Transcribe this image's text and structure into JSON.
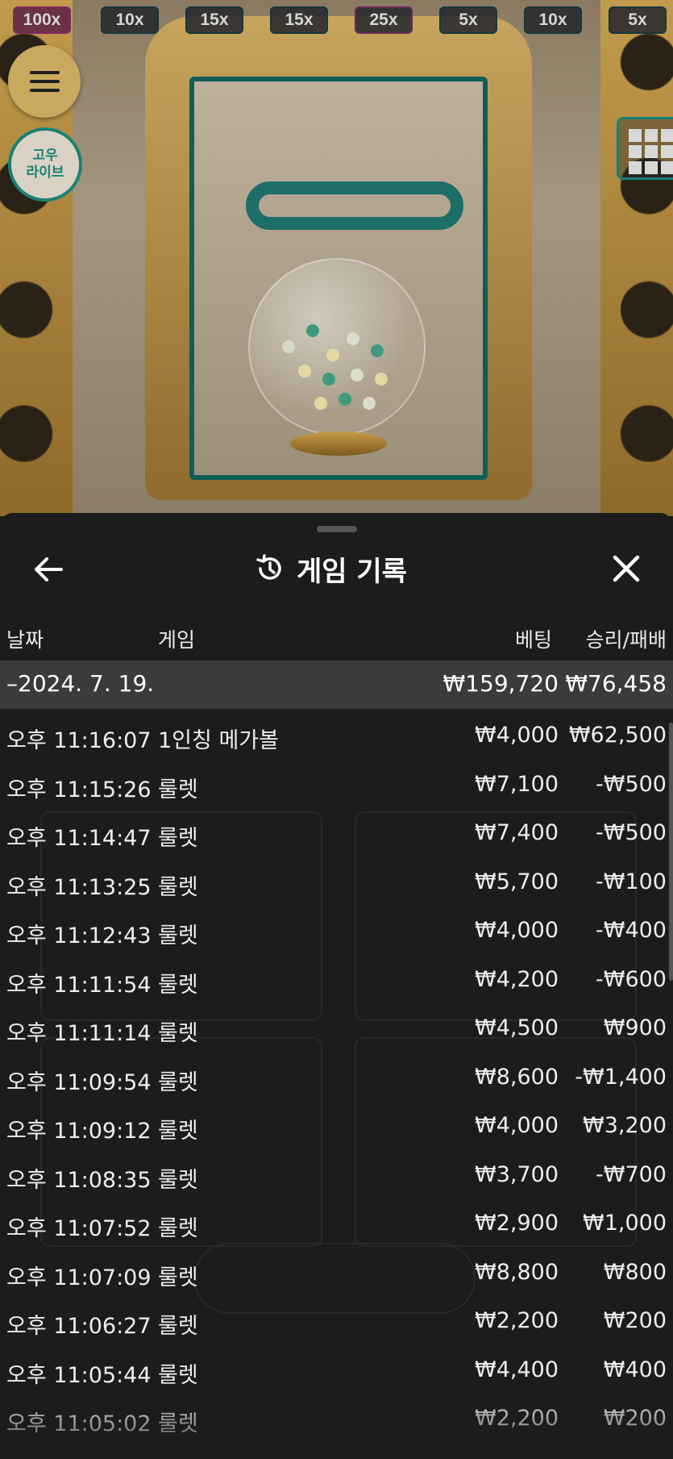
{
  "multipliers": [
    {
      "label": "100x",
      "tone": "high"
    },
    {
      "label": "10x",
      "tone": "normal"
    },
    {
      "label": "15x",
      "tone": "normal"
    },
    {
      "label": "15x",
      "tone": "normal"
    },
    {
      "label": "25x",
      "tone": "mid"
    },
    {
      "label": "5x",
      "tone": "normal"
    },
    {
      "label": "10x",
      "tone": "normal"
    },
    {
      "label": "5x",
      "tone": "normal"
    }
  ],
  "brand": {
    "line1": "고우",
    "line2": "라이브"
  },
  "panel": {
    "title": "게임 기록",
    "columns": {
      "date": "날짜",
      "game": "게임",
      "bet": "베팅",
      "winloss": "승리/패배"
    },
    "date_group": {
      "date": "–2024. 7. 19.",
      "bet_total": "₩159,720",
      "winloss_total": "₩76,458"
    },
    "rows": [
      {
        "time": "오후 11:16:07",
        "game": "1인칭 메가볼",
        "bet": "₩4,000",
        "winloss": "₩62,500"
      },
      {
        "time": "오후 11:15:26",
        "game": "룰렛",
        "bet": "₩7,100",
        "winloss": "-₩500"
      },
      {
        "time": "오후 11:14:47",
        "game": "룰렛",
        "bet": "₩7,400",
        "winloss": "-₩500"
      },
      {
        "time": "오후 11:13:25",
        "game": "룰렛",
        "bet": "₩5,700",
        "winloss": "-₩100"
      },
      {
        "time": "오후 11:12:43",
        "game": "룰렛",
        "bet": "₩4,000",
        "winloss": "-₩400"
      },
      {
        "time": "오후 11:11:54",
        "game": "룰렛",
        "bet": "₩4,200",
        "winloss": "-₩600"
      },
      {
        "time": "오후 11:11:14",
        "game": "룰렛",
        "bet": "₩4,500",
        "winloss": "₩900"
      },
      {
        "time": "오후 11:09:54",
        "game": "룰렛",
        "bet": "₩8,600",
        "winloss": "-₩1,400"
      },
      {
        "time": "오후 11:09:12",
        "game": "룰렛",
        "bet": "₩4,000",
        "winloss": "₩3,200"
      },
      {
        "time": "오후 11:08:35",
        "game": "룰렛",
        "bet": "₩3,700",
        "winloss": "-₩700"
      },
      {
        "time": "오후 11:07:52",
        "game": "룰렛",
        "bet": "₩2,900",
        "winloss": "₩1,000"
      },
      {
        "time": "오후 11:07:09",
        "game": "룰렛",
        "bet": "₩8,800",
        "winloss": "₩800"
      },
      {
        "time": "오후 11:06:27",
        "game": "룰렛",
        "bet": "₩2,200",
        "winloss": "₩200"
      },
      {
        "time": "오후 11:05:44",
        "game": "룰렛",
        "bet": "₩4,400",
        "winloss": "₩400"
      },
      {
        "time": "오후 11:05:02",
        "game": "룰렛",
        "bet": "₩2,200",
        "winloss": "₩200"
      }
    ]
  },
  "icons": {
    "menu": "hamburger-icon",
    "back": "arrow-left-icon",
    "history": "history-icon",
    "close": "close-icon",
    "grid": "grid-icon"
  },
  "colors": {
    "accent_teal": "#1a8074",
    "gold": "#c9a95e",
    "panel_bg": "#1c1c1c",
    "date_row_bg": "#3b3b3b"
  }
}
